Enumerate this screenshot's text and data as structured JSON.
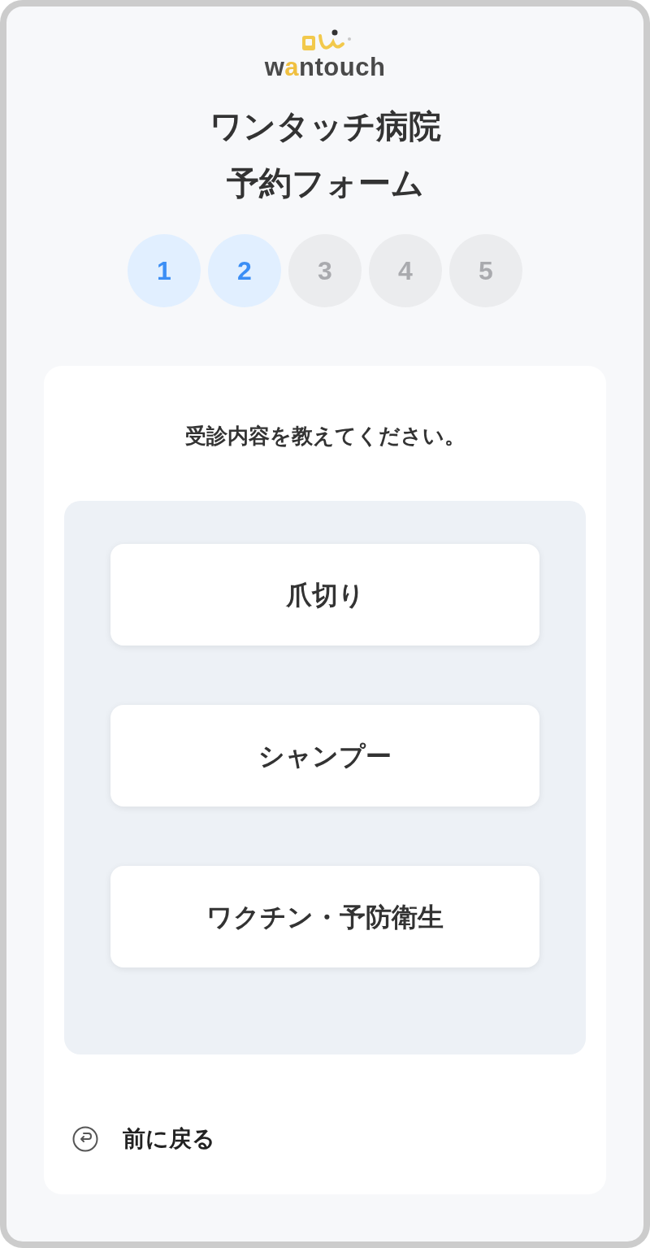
{
  "logo": {
    "wordmark": [
      {
        "text": "w",
        "accent": false
      },
      {
        "text": "a",
        "accent": true
      },
      {
        "text": "ntouch",
        "accent": false
      }
    ]
  },
  "title": [
    "ワンタッチ病院",
    "予約フォーム"
  ],
  "steps": [
    {
      "label": "1",
      "active": true
    },
    {
      "label": "2",
      "active": true
    },
    {
      "label": "3",
      "active": false
    },
    {
      "label": "4",
      "active": false
    },
    {
      "label": "5",
      "active": false
    }
  ],
  "question": "受診内容を教えてください。",
  "options": [
    {
      "label": "爪切り"
    },
    {
      "label": "シャンプー"
    },
    {
      "label": "ワクチン・予防衛生"
    }
  ],
  "back_link": {
    "label": "前に戻る"
  }
}
